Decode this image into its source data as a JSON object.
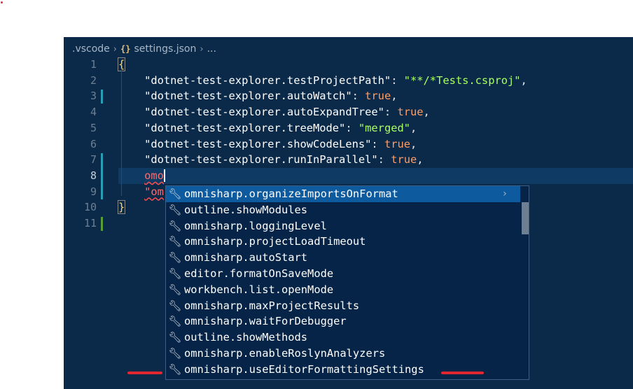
{
  "breadcrumb": {
    "folder": ".vscode",
    "file_icon": "{}",
    "file": "settings.json",
    "more": "..."
  },
  "line_numbers": [
    "1",
    "2",
    "3",
    "4",
    "5",
    "6",
    "7",
    "8",
    "9",
    "10",
    "11"
  ],
  "code": {
    "l1_brace": "{",
    "l2_key": "\"dotnet-test-explorer.testProjectPath\"",
    "l2_val": "\"**/*Tests.csproj\"",
    "l3_key": "\"dotnet-test-explorer.autoWatch\"",
    "l3_val": "true",
    "l4_key": "\"dotnet-test-explorer.autoExpandTree\"",
    "l4_val": "true",
    "l5_key": "\"dotnet-test-explorer.treeMode\"",
    "l5_val": "\"merged\"",
    "l6_key": "\"dotnet-test-explorer.showCodeLens\"",
    "l6_val": "true",
    "l7_key": "\"dotnet-test-explorer.runInParallel\"",
    "l7_val": "true",
    "l8_typed": "omo",
    "l9_partial": "\"om",
    "l10_brace": "}"
  },
  "suggestions": [
    "omnisharp.organizeImportsOnFormat",
    "outline.showModules",
    "omnisharp.loggingLevel",
    "omnisharp.projectLoadTimeout",
    "omnisharp.autoStart",
    "editor.formatOnSaveMode",
    "workbench.list.openMode",
    "omnisharp.maxProjectResults",
    "omnisharp.waitForDebugger",
    "outline.showMethods",
    "omnisharp.enableRoslynAnalyzers",
    "omnisharp.useEditorFormattingSettings"
  ],
  "icons": {
    "suggestion": "wrench-icon",
    "details": "chevron-right-icon",
    "separator": "chevron-right-icon"
  },
  "colors": {
    "editor_bg": "#0b2a4a",
    "selected": "#0e5a9e",
    "string": "#a8ff60",
    "boolean": "#ff9e64",
    "annotation": "#e0262e"
  }
}
